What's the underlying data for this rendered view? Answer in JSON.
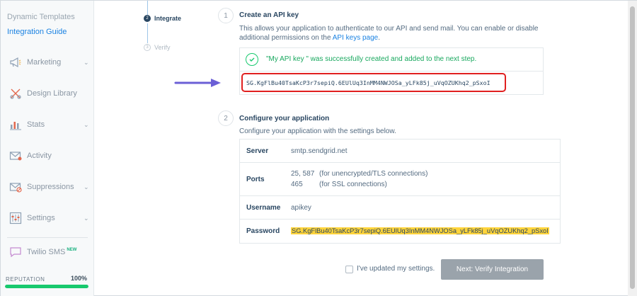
{
  "sidebar": {
    "sub_links": [
      "Dynamic Templates",
      "Integration Guide"
    ],
    "items": [
      {
        "label": "Marketing",
        "icon": "megaphone-icon",
        "chevron": true
      },
      {
        "label": "Design Library",
        "icon": "design-tools-icon",
        "chevron": false
      },
      {
        "label": "Stats",
        "icon": "bar-chart-icon",
        "chevron": true
      },
      {
        "label": "Activity",
        "icon": "envelope-activity-icon",
        "chevron": false
      },
      {
        "label": "Suppressions",
        "icon": "envelope-block-icon",
        "chevron": true
      },
      {
        "label": "Settings",
        "icon": "sliders-icon",
        "chevron": true
      }
    ],
    "sms": {
      "label": "Twilio SMS",
      "badge": "NEW"
    },
    "reputation": {
      "label": "REPUTATION",
      "value": "100%",
      "percent": 100,
      "bar_color": "#18c96e"
    }
  },
  "steps": [
    {
      "number": "2",
      "label": "Integrate",
      "state": "active"
    },
    {
      "number": "3",
      "label": "Verify",
      "state": "inactive"
    }
  ],
  "section1": {
    "number": "1",
    "title": "Create an API key",
    "desc_line1": "This allows your application to authenticate to our API and send mail. You can enable or disable",
    "desc_line2_prefix": "additional permissions on the ",
    "desc_link": "API keys page",
    "desc_line2_suffix": ".",
    "success_message": "\"My API key \" was successfully created and added to the next step.",
    "api_key": "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"
  },
  "section2": {
    "number": "2",
    "title": "Configure your application",
    "desc": "Configure your application with the settings below.",
    "rows": {
      "server": {
        "label": "Server",
        "value": "smtp.sendgrid.net"
      },
      "ports": {
        "label": "Ports",
        "entries": [
          {
            "port": "25, 587",
            "note": "(for unencrypted/TLS connections)"
          },
          {
            "port": "465",
            "note": "(for SSL connections)"
          }
        ]
      },
      "username": {
        "label": "Username",
        "value": "apikey"
      },
      "password": {
        "label": "Password",
        "value": "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"
      }
    }
  },
  "footer": {
    "checkbox_label": "I've updated my settings.",
    "next_button": "Next: Verify Integration"
  },
  "colors": {
    "accent": "#1a82e2",
    "success": "#18c96e",
    "highlight": "#ffd43b",
    "key_border": "#e02020",
    "arrow": "#6b5fd6"
  }
}
